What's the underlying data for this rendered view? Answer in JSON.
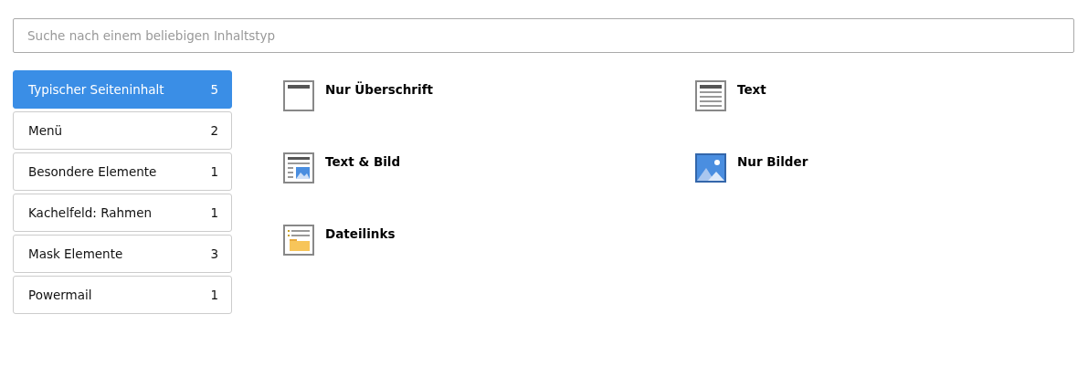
{
  "search": {
    "placeholder": "Suche nach einem beliebigen Inhaltstyp"
  },
  "categories": [
    {
      "label": "Typischer Seiteninhalt",
      "count": "5",
      "selected": true
    },
    {
      "label": "Menü",
      "count": "2",
      "selected": false
    },
    {
      "label": "Besondere Elemente",
      "count": "1",
      "selected": false
    },
    {
      "label": "Kachelfeld: Rahmen",
      "count": "1",
      "selected": false
    },
    {
      "label": "Mask Elemente",
      "count": "3",
      "selected": false
    },
    {
      "label": "Powermail",
      "count": "1",
      "selected": false
    }
  ],
  "elements": [
    {
      "label": "Nur Überschrift",
      "kind": "header"
    },
    {
      "label": "Text",
      "kind": "text"
    },
    {
      "label": "Text & Bild",
      "kind": "textpic"
    },
    {
      "label": "Nur Bilder",
      "kind": "image"
    },
    {
      "label": "Dateilinks",
      "kind": "files"
    }
  ]
}
